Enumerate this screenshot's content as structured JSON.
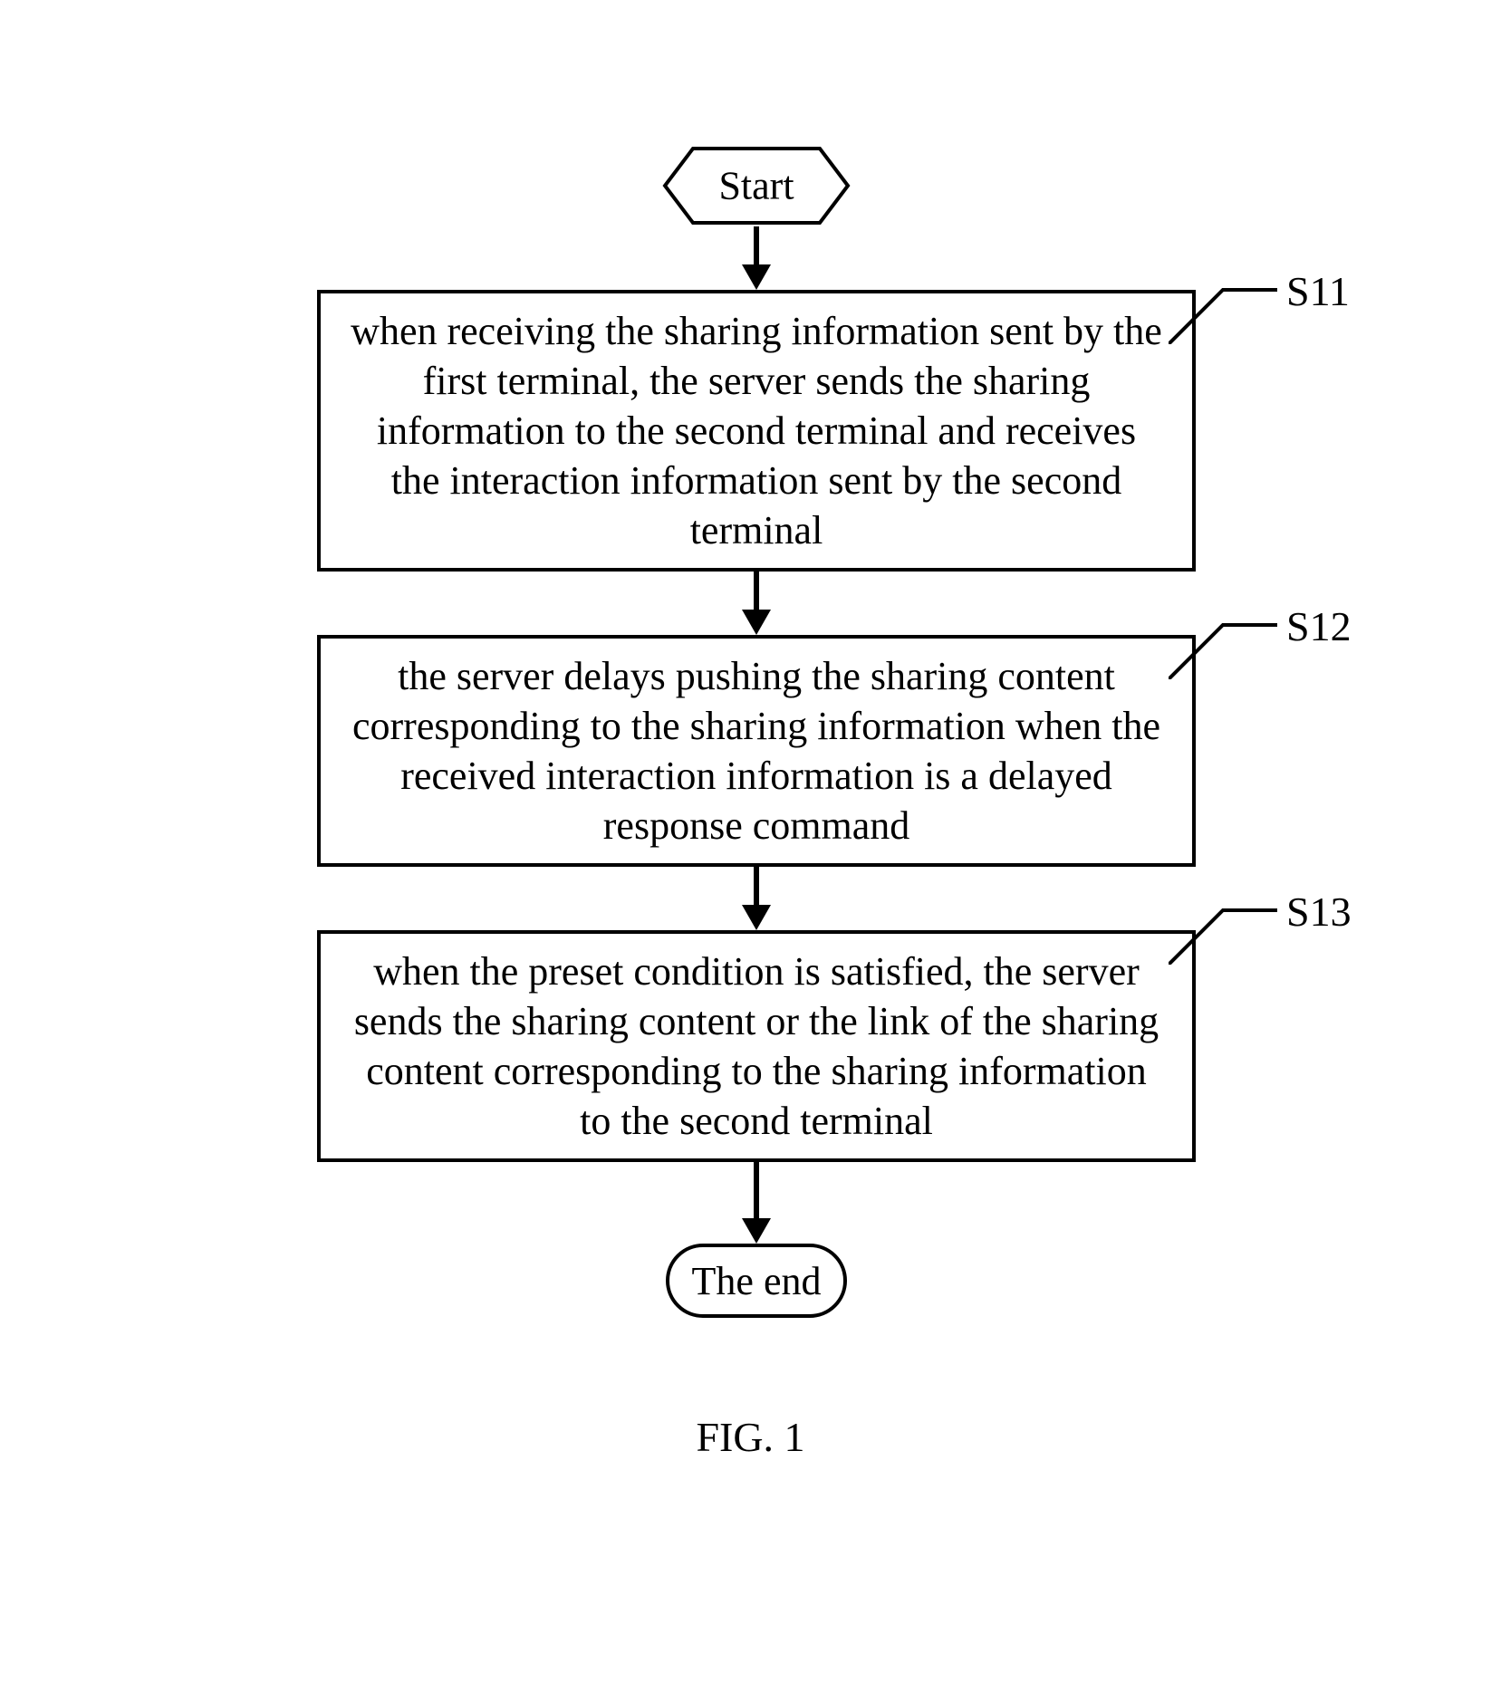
{
  "chart_data": {
    "type": "flowchart",
    "title": "FIG. 1",
    "nodes": [
      {
        "id": "start",
        "shape": "hexagon",
        "text": "Start"
      },
      {
        "id": "s11",
        "shape": "process",
        "label": "S11",
        "text": "when receiving the sharing information sent by the first terminal, the server sends the sharing information to the second terminal and receives the interaction information sent by the second terminal"
      },
      {
        "id": "s12",
        "shape": "process",
        "label": "S12",
        "text": "the server delays pushing the sharing content corresponding to the sharing information when the received interaction information is a delayed response command"
      },
      {
        "id": "s13",
        "shape": "process",
        "label": "S13",
        "text": "when the preset condition is satisfied, the server sends the sharing content or the link of the sharing content corresponding to the sharing information to the second terminal"
      },
      {
        "id": "end",
        "shape": "terminator",
        "text": "The end"
      }
    ],
    "edges": [
      {
        "from": "start",
        "to": "s11"
      },
      {
        "from": "s11",
        "to": "s12"
      },
      {
        "from": "s12",
        "to": "s13"
      },
      {
        "from": "s13",
        "to": "end"
      }
    ]
  },
  "start": {
    "text": "Start"
  },
  "steps": [
    {
      "label": "S11",
      "text": "when receiving the sharing information sent by the first terminal, the server sends the sharing information to the second terminal and receives the interaction information sent by the second terminal"
    },
    {
      "label": "S12",
      "text": "the server delays pushing the sharing content corresponding to the sharing information when the received interaction information is a delayed response command"
    },
    {
      "label": "S13",
      "text": "when the preset condition is satisfied, the server sends the sharing content or the link of the sharing content corresponding to the sharing information to the second terminal"
    }
  ],
  "end": {
    "text": "The end"
  },
  "figure_label": "FIG. 1"
}
